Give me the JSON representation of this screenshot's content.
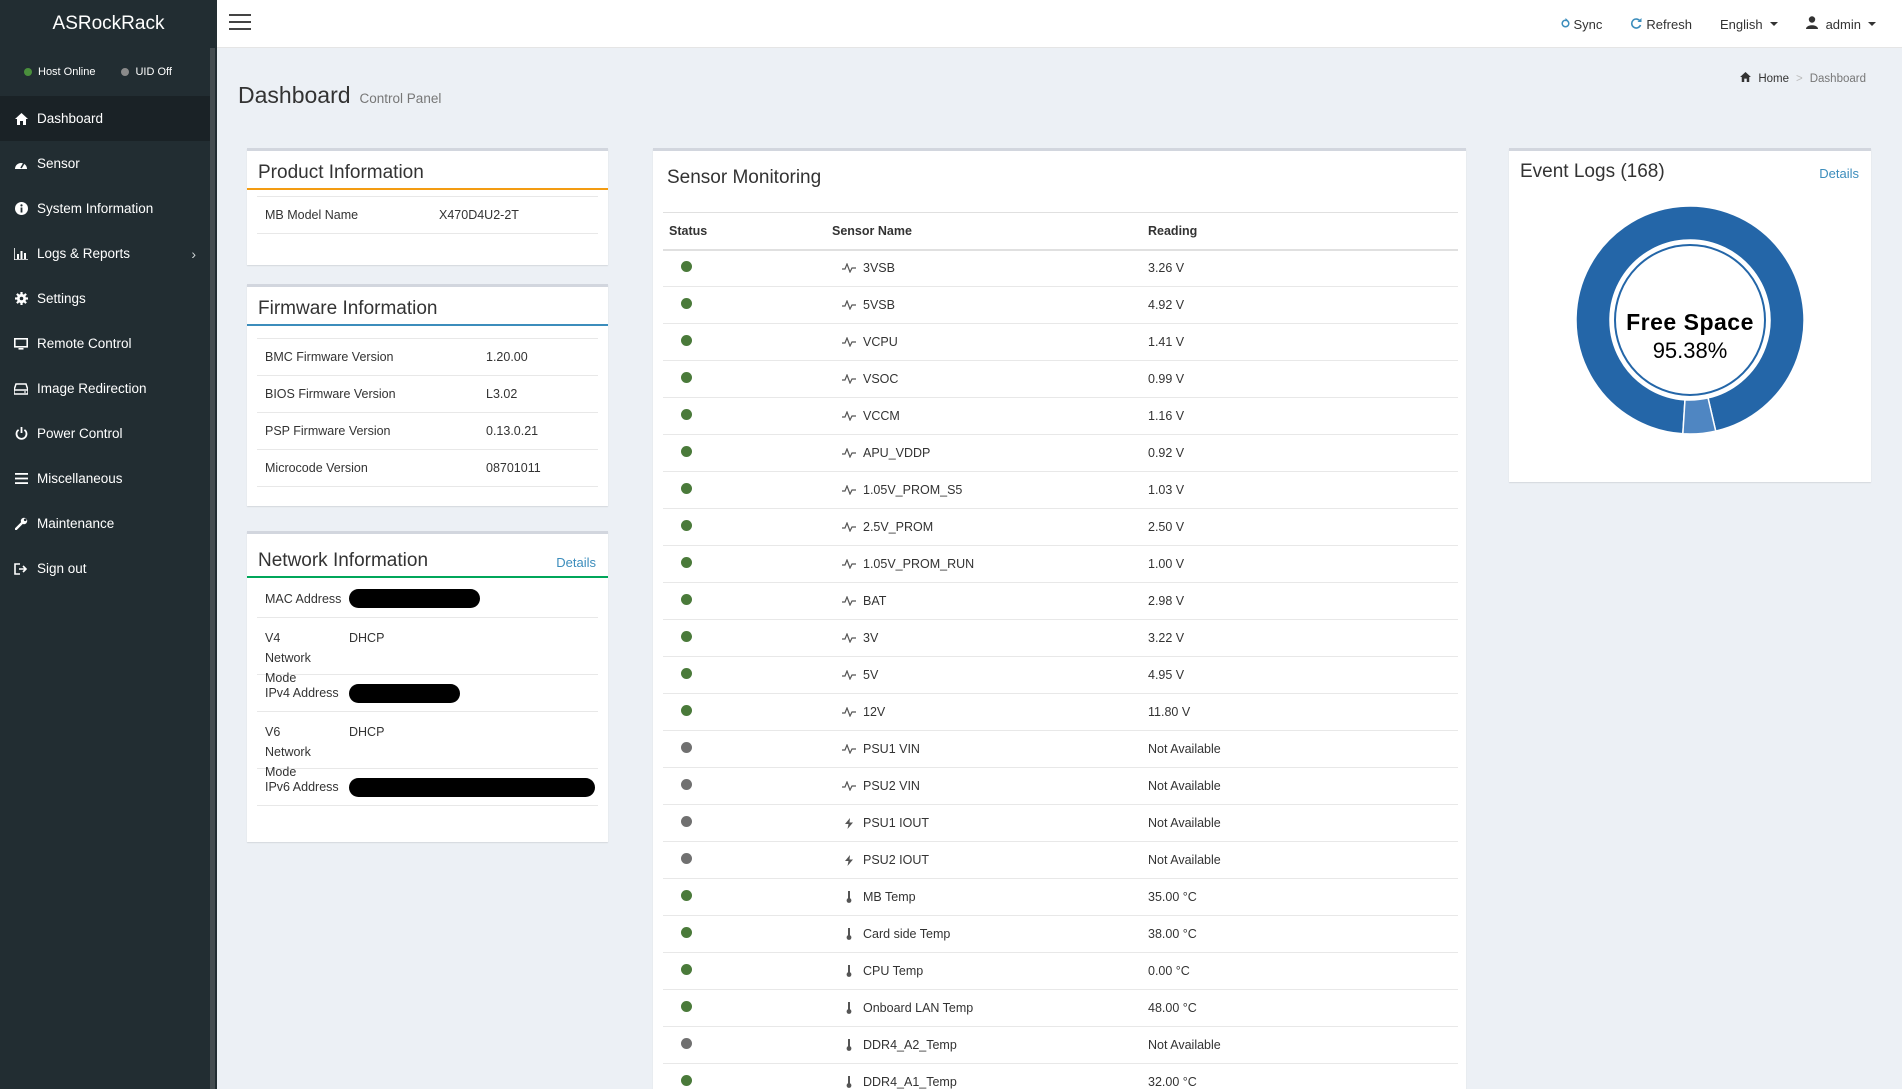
{
  "brand": "ASRockRack",
  "host_status": {
    "label": "Host Online",
    "color": "#4a8f3c"
  },
  "uid_status": {
    "label": "UID Off",
    "color": "#8a8a8a"
  },
  "sidebar": {
    "items": [
      {
        "label": "Dashboard",
        "icon": "home-icon"
      },
      {
        "label": "Sensor",
        "icon": "dashboard-gauge-icon"
      },
      {
        "label": "System Information",
        "icon": "info-circle-icon"
      },
      {
        "label": "Logs & Reports",
        "icon": "bar-chart-icon"
      },
      {
        "label": "Settings",
        "icon": "gear-icon"
      },
      {
        "label": "Remote Control",
        "icon": "desktop-icon"
      },
      {
        "label": "Image Redirection",
        "icon": "hdd-icon"
      },
      {
        "label": "Power Control",
        "icon": "power-icon"
      },
      {
        "label": "Miscellaneous",
        "icon": "list-icon"
      },
      {
        "label": "Maintenance",
        "icon": "wrench-icon"
      },
      {
        "label": "Sign out",
        "icon": "sign-out-icon"
      }
    ]
  },
  "topbar": {
    "sync": "Sync",
    "refresh": "Refresh",
    "language": "English",
    "user": "admin"
  },
  "header": {
    "title": "Dashboard",
    "subtitle": "Control Panel"
  },
  "breadcrumb": {
    "home": "Home",
    "current": "Dashboard"
  },
  "product": {
    "title": "Product Information",
    "accent": "#f39c12",
    "rows": [
      {
        "label": "MB Model Name",
        "value": "X470D4U2-2T"
      }
    ]
  },
  "firmware": {
    "title": "Firmware Information",
    "accent": "#3c8dbc",
    "rows": [
      {
        "label": "BMC Firmware Version",
        "value": "1.20.00"
      },
      {
        "label": "BIOS Firmware Version",
        "value": "L3.02"
      },
      {
        "label": "PSP Firmware Version",
        "value": "0.13.0.21"
      },
      {
        "label": "Microcode Version",
        "value": "08701011"
      }
    ]
  },
  "network": {
    "title": "Network Information",
    "details": "Details",
    "accent": "#00a65a",
    "mac_label": "MAC Address",
    "v4_label": "V4 Network Mode",
    "v4_value": "DHCP",
    "ipv4_label": "IPv4 Address",
    "v6_label": "V6 Network Mode",
    "v6_value": "DHCP",
    "ipv6_label": "IPv6 Address"
  },
  "sensors": {
    "title": "Sensor Monitoring",
    "columns": [
      "Status",
      "Sensor Name",
      "Reading"
    ],
    "rows": [
      {
        "status": "ok",
        "icon": "voltage-icon",
        "name": "3VSB",
        "reading": "3.26 V"
      },
      {
        "status": "ok",
        "icon": "voltage-icon",
        "name": "5VSB",
        "reading": "4.92 V"
      },
      {
        "status": "ok",
        "icon": "voltage-icon",
        "name": "VCPU",
        "reading": "1.41 V"
      },
      {
        "status": "ok",
        "icon": "voltage-icon",
        "name": "VSOC",
        "reading": "0.99 V"
      },
      {
        "status": "ok",
        "icon": "voltage-icon",
        "name": "VCCM",
        "reading": "1.16 V"
      },
      {
        "status": "ok",
        "icon": "voltage-icon",
        "name": "APU_VDDP",
        "reading": "0.92 V"
      },
      {
        "status": "ok",
        "icon": "voltage-icon",
        "name": "1.05V_PROM_S5",
        "reading": "1.03 V"
      },
      {
        "status": "ok",
        "icon": "voltage-icon",
        "name": "2.5V_PROM",
        "reading": "2.50 V"
      },
      {
        "status": "ok",
        "icon": "voltage-icon",
        "name": "1.05V_PROM_RUN",
        "reading": "1.00 V"
      },
      {
        "status": "ok",
        "icon": "voltage-icon",
        "name": "BAT",
        "reading": "2.98 V"
      },
      {
        "status": "ok",
        "icon": "voltage-icon",
        "name": "3V",
        "reading": "3.22 V"
      },
      {
        "status": "ok",
        "icon": "voltage-icon",
        "name": "5V",
        "reading": "4.95 V"
      },
      {
        "status": "ok",
        "icon": "voltage-icon",
        "name": "12V",
        "reading": "11.80 V"
      },
      {
        "status": "na",
        "icon": "voltage-icon",
        "name": "PSU1 VIN",
        "reading": "Not Available"
      },
      {
        "status": "na",
        "icon": "voltage-icon",
        "name": "PSU2 VIN",
        "reading": "Not Available"
      },
      {
        "status": "na",
        "icon": "current-bolt-icon",
        "name": "PSU1 IOUT",
        "reading": "Not Available"
      },
      {
        "status": "na",
        "icon": "current-bolt-icon",
        "name": "PSU2 IOUT",
        "reading": "Not Available"
      },
      {
        "status": "ok",
        "icon": "thermometer-icon",
        "name": "MB Temp",
        "reading": "35.00 °C"
      },
      {
        "status": "ok",
        "icon": "thermometer-icon",
        "name": "Card side Temp",
        "reading": "38.00 °C"
      },
      {
        "status": "ok",
        "icon": "thermometer-icon",
        "name": "CPU Temp",
        "reading": "0.00 °C"
      },
      {
        "status": "ok",
        "icon": "thermometer-icon",
        "name": "Onboard LAN Temp",
        "reading": "48.00 °C"
      },
      {
        "status": "na",
        "icon": "thermometer-icon",
        "name": "DDR4_A2_Temp",
        "reading": "Not Available"
      },
      {
        "status": "ok",
        "icon": "thermometer-icon",
        "name": "DDR4_A1_Temp",
        "reading": "32.00 °C"
      }
    ],
    "status_colors": {
      "ok": "#4a7a3a",
      "na": "#707070"
    }
  },
  "events": {
    "title": "Event Logs (168)",
    "details": "Details",
    "donut_label": "Free Space",
    "donut_value": "95.38%",
    "free_fraction": 0.9538,
    "colors": {
      "free": "#2466a8",
      "used": "#4f86c2"
    }
  }
}
